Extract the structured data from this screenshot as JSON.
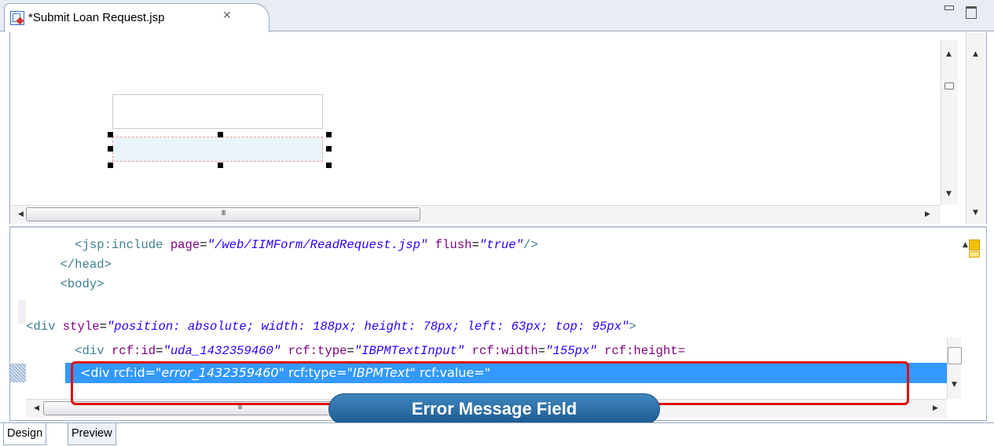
{
  "editor": {
    "tab_title": "*Submit Loan Request.jsp",
    "tab_close": "✕"
  },
  "design_scroll": {
    "h_thumb_grip": "III"
  },
  "source": {
    "lines": [
      {
        "indent": "      ",
        "parts": [
          {
            "t": "<jsp:include ",
            "c": "tag"
          },
          {
            "t": "page",
            "c": "attr"
          },
          {
            "t": "=",
            "c": "plain"
          },
          {
            "t": "\"/web/IIMForm/ReadRequest.jsp\"",
            "c": "val"
          },
          {
            "t": " ",
            "c": "plain"
          },
          {
            "t": "flush",
            "c": "attr"
          },
          {
            "t": "=",
            "c": "plain"
          },
          {
            "t": "\"true\"",
            "c": "val"
          },
          {
            "t": "/>",
            "c": "tag"
          }
        ]
      },
      {
        "indent": "    ",
        "parts": [
          {
            "t": "</head>",
            "c": "tag"
          }
        ]
      },
      {
        "indent": "    ",
        "parts": [
          {
            "t": "<body>",
            "c": "tag"
          }
        ]
      },
      {
        "indent": "",
        "parts": []
      },
      {
        "indent": "",
        "parts": [
          {
            "t": "<div ",
            "c": "tag"
          },
          {
            "t": "style",
            "c": "attr"
          },
          {
            "t": "=",
            "c": "plain"
          },
          {
            "t": "\"position: absolute; width: 188px; height: 78px; left: 63px; top: 95px\"",
            "c": "val"
          },
          {
            "t": ">",
            "c": "tag"
          }
        ]
      },
      {
        "indent": "      ",
        "parts": [
          {
            "t": "<div ",
            "c": "tag"
          },
          {
            "t": "rcf:id",
            "c": "attr"
          },
          {
            "t": "=",
            "c": "plain"
          },
          {
            "t": "\"uda_1432359460\"",
            "c": "val"
          },
          {
            "t": " ",
            "c": "plain"
          },
          {
            "t": "rcf:type",
            "c": "attr"
          },
          {
            "t": "=",
            "c": "plain"
          },
          {
            "t": "\"IBPMTextInput\"",
            "c": "val"
          },
          {
            "t": " ",
            "c": "plain"
          },
          {
            "t": "rcf:width",
            "c": "attr"
          },
          {
            "t": "=",
            "c": "plain"
          },
          {
            "t": "\"155px\"",
            "c": "val"
          },
          {
            "t": " ",
            "c": "plain"
          },
          {
            "t": "rcf:height=",
            "c": "attr"
          }
        ]
      }
    ],
    "selected_line": [
      {
        "t": "<div ",
        "c": "tag"
      },
      {
        "t": "rcf:id",
        "c": "attr"
      },
      {
        "t": "=",
        "c": "plain"
      },
      {
        "t": "\"error_1432359460\"",
        "c": "val"
      },
      {
        "t": " ",
        "c": "plain"
      },
      {
        "t": "rcf:type",
        "c": "attr"
      },
      {
        "t": "=",
        "c": "plain"
      },
      {
        "t": "\"IBPMText\"",
        "c": "val"
      },
      {
        "t": " ",
        "c": "plain"
      },
      {
        "t": "rcf:value",
        "c": "attr"
      },
      {
        "t": "=",
        "c": "plain"
      },
      {
        "t": "\"",
        "c": "val"
      }
    ],
    "h_thumb_grip": "III"
  },
  "callout": {
    "label": "Error Message Field"
  },
  "bottom_tabs": {
    "design": "Design",
    "preview": "Preview"
  },
  "colors": {
    "selection": "#3399ff",
    "highlight_border": "#e01010",
    "callout_bg": "#2a6ea6",
    "tag": "#3e7f91",
    "attr": "#7f007f",
    "value": "#2a00ff"
  }
}
